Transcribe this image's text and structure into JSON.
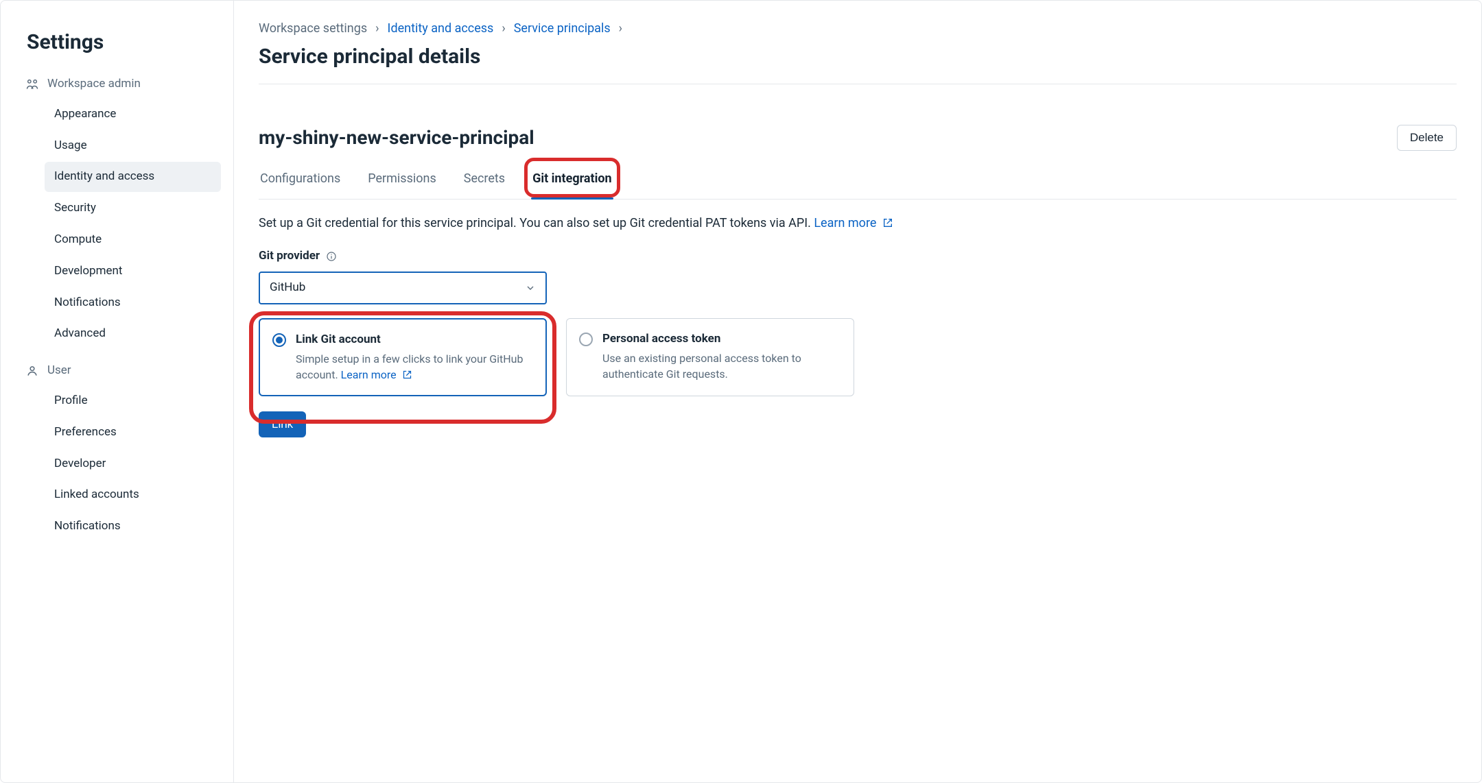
{
  "sidebar": {
    "title": "Settings",
    "sections": [
      {
        "label": "Workspace admin",
        "icon": "workspace-admin-icon",
        "items": [
          {
            "label": "Appearance"
          },
          {
            "label": "Usage"
          },
          {
            "label": "Identity and access",
            "active": true
          },
          {
            "label": "Security"
          },
          {
            "label": "Compute"
          },
          {
            "label": "Development"
          },
          {
            "label": "Notifications"
          },
          {
            "label": "Advanced"
          }
        ]
      },
      {
        "label": "User",
        "icon": "user-icon",
        "items": [
          {
            "label": "Profile"
          },
          {
            "label": "Preferences"
          },
          {
            "label": "Developer"
          },
          {
            "label": "Linked accounts"
          },
          {
            "label": "Notifications"
          }
        ]
      }
    ]
  },
  "breadcrumbs": [
    {
      "label": "Workspace settings",
      "link": false
    },
    {
      "label": "Identity and access",
      "link": true
    },
    {
      "label": "Service principals",
      "link": true
    }
  ],
  "page": {
    "title": "Service principal details",
    "entity_name": "my-shiny-new-service-principal",
    "delete_label": "Delete"
  },
  "tabs": [
    {
      "label": "Configurations"
    },
    {
      "label": "Permissions"
    },
    {
      "label": "Secrets"
    },
    {
      "label": "Git integration",
      "active": true
    }
  ],
  "git": {
    "desc_prefix": "Set up a Git credential for this service principal. You can also set up Git credential PAT tokens via API. ",
    "learn_more": "Learn more",
    "provider_label": "Git provider",
    "provider_value": "GitHub",
    "options": [
      {
        "title": "Link Git account",
        "desc_prefix": "Simple setup in a few clicks to link your GitHub account. ",
        "learn_more": "Learn more",
        "selected": true
      },
      {
        "title": "Personal access token",
        "desc": "Use an existing personal access token to authenticate Git requests.",
        "selected": false
      }
    ],
    "link_button": "Link"
  }
}
